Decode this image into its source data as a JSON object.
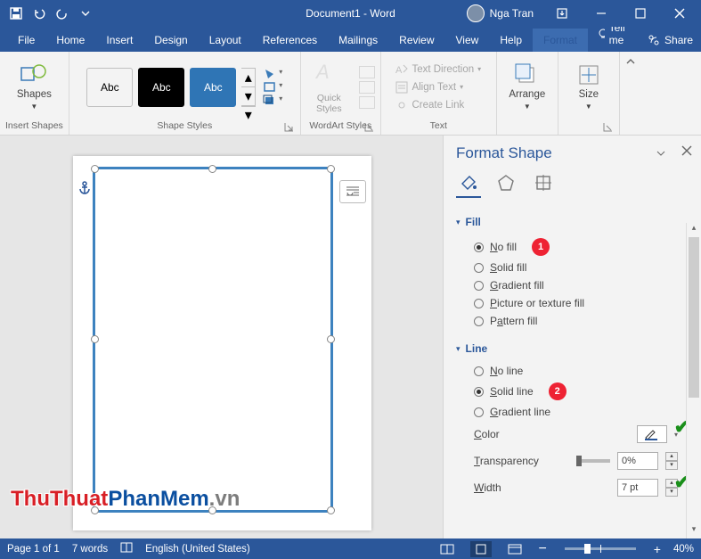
{
  "title": "Document1 - Word",
  "user": {
    "name": "Nga Tran"
  },
  "qat": {
    "save": "Save",
    "undo": "Undo",
    "redo": "Redo"
  },
  "tabs": {
    "file": "File",
    "home": "Home",
    "insert": "Insert",
    "design": "Design",
    "layout": "Layout",
    "references": "References",
    "mailings": "Mailings",
    "review": "Review",
    "view": "View",
    "help": "Help",
    "format": "Format",
    "tellme": "Tell me",
    "share": "Share"
  },
  "ribbon": {
    "insert_shapes": {
      "shapes": "Shapes",
      "group": "Insert Shapes"
    },
    "shape_styles": {
      "sample": "Abc",
      "group": "Shape Styles"
    },
    "quick_styles": "Quick Styles",
    "wordart": {
      "group": "WordArt Styles"
    },
    "text": {
      "direction": "Text Direction",
      "align": "Align Text",
      "link": "Create Link",
      "group": "Text"
    },
    "arrange": "Arrange",
    "size": "Size"
  },
  "pane": {
    "title": "Format Shape",
    "fill": {
      "header": "Fill",
      "options": [
        "No fill",
        "Solid fill",
        "Gradient fill",
        "Picture or texture fill",
        "Pattern fill"
      ],
      "selected": 0
    },
    "line": {
      "header": "Line",
      "options": [
        "No line",
        "Solid line",
        "Gradient line"
      ],
      "selected": 1
    },
    "color_label": "Color",
    "transparency_label": "Transparency",
    "transparency_value": "0%",
    "width_label": "Width",
    "width_value": "7 pt"
  },
  "badges": {
    "one": "1",
    "two": "2"
  },
  "status": {
    "page": "Page 1 of 1",
    "words": "7 words",
    "lang": "English (United States)",
    "zoom": "40%"
  },
  "watermark": {
    "a": "ThuThuat",
    "b": "PhanMem",
    "c": ".vn"
  }
}
